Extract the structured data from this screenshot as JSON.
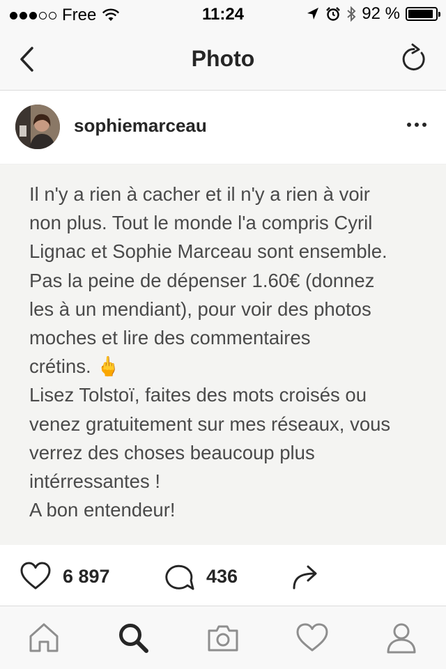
{
  "status_bar": {
    "signal_dots_filled": 3,
    "signal_dots_total": 5,
    "carrier": "Free",
    "time": "11:24",
    "battery": "92 %",
    "battery_level": 0.92
  },
  "nav": {
    "title": "Photo",
    "back_icon": "chevron-left-icon",
    "refresh_icon": "refresh-icon"
  },
  "post": {
    "username": "sophiemarceau",
    "more_icon": "ellipsis-icon",
    "text": "Il n'y a rien à cacher et il n'y a rien à voir\nnon plus. Tout le monde l'a compris Cyril\nLignac et Sophie Marceau sont ensemble.\nPas la peine de dépenser 1.60€ (donnez\nles à un mendiant), pour voir des photos\nmoches et lire des commentaires\ncrétins. 🖕\nLisez Tolstoï, faites des mots croisés ou\nvenez gratuitement sur mes réseaux, vous\nverrez des choses beaucoup plus\nintérressantes !\nA bon entendeur!"
  },
  "actions": {
    "likes": "6 897",
    "comments": "436",
    "like_icon": "heart-icon",
    "comment_icon": "comment-bubble-icon",
    "share_icon": "share-arrow-icon"
  },
  "tab_bar": {
    "tabs": [
      "home-icon",
      "search-icon",
      "camera-icon",
      "activity-heart-icon",
      "profile-icon"
    ],
    "active": "search-icon"
  },
  "colors": {
    "text_primary": "#262626",
    "image_text": "#4a4a4a",
    "bar_background": "#f8f8f8",
    "image_background": "#f4f4f2"
  }
}
